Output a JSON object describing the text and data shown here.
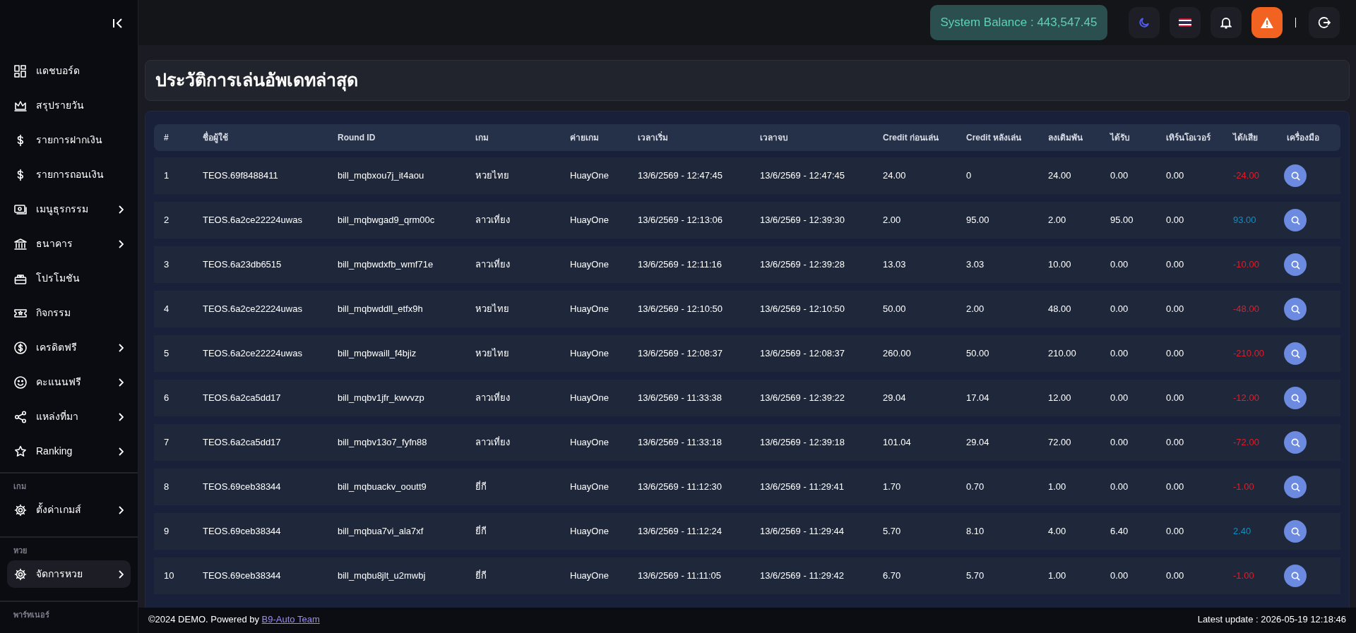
{
  "sidebar": {
    "sections": [
      {
        "items": [
          {
            "label": "แดชบอร์ด",
            "has_submenu": false,
            "selected": false
          },
          {
            "label": "สรุปรายวัน",
            "has_submenu": false,
            "selected": false
          },
          {
            "label": "รายการฝากเงิน",
            "has_submenu": false,
            "selected": false
          },
          {
            "label": "รายการถอนเงิน",
            "has_submenu": false,
            "selected": false
          },
          {
            "label": "เมนูธุรกรรม",
            "has_submenu": true,
            "selected": false
          },
          {
            "label": "ธนาคาร",
            "has_submenu": true,
            "selected": false
          },
          {
            "label": "โปรโมชัน",
            "has_submenu": false,
            "selected": false
          },
          {
            "label": "กิจกรรม",
            "has_submenu": false,
            "selected": false
          },
          {
            "label": "เครดิตฟรี",
            "has_submenu": true,
            "selected": false
          },
          {
            "label": "คะแนนฟรี",
            "has_submenu": true,
            "selected": false
          },
          {
            "label": "แหล่งที่มา",
            "has_submenu": true,
            "selected": false
          },
          {
            "label": "Ranking",
            "has_submenu": true,
            "selected": false
          }
        ]
      },
      {
        "label": "เกม",
        "items": [
          {
            "label": "ตั้งค่าเกมส์",
            "has_submenu": true,
            "selected": false
          }
        ]
      },
      {
        "label": "หวย",
        "items": [
          {
            "label": "จัดการหวย",
            "has_submenu": true,
            "selected": true
          }
        ]
      },
      {
        "label": "พาร์ทเนอร์"
      }
    ]
  },
  "header": {
    "balance": "System Balance : 443,547.45"
  },
  "page_title": "ประวัติการเล่นอัพเดทล่าสุด",
  "table": {
    "columns": [
      "#",
      "ชื่อผู้ใช้",
      "Round ID",
      "เกม",
      "ค่ายเกม",
      "เวลาเริ่ม",
      "เวลาจบ",
      "Credit ก่อนเล่น",
      "Credit หลังเล่น",
      "ลงเดิมพัน",
      "ได้รับ",
      "เทิร์นโอเวอร์",
      "ได้/เสีย",
      "เครื่องมือ"
    ],
    "rows": [
      {
        "cells": [
          "1",
          "TEOS.69f8488411",
          "bill_mqbxou7j_it4aou",
          "หวยไทย",
          "HuayOne",
          "13/6/2569 - 12:47:45",
          "13/6/2569 - 12:47:45",
          "24.00",
          "0",
          "24.00",
          "0.00",
          "0.00",
          "-24.00"
        ],
        "color": "#e11d2a"
      },
      {
        "cells": [
          "2",
          "TEOS.6a2ce22224uwas",
          "bill_mqbwgad9_qrm00c",
          "ลาวเที่ยง",
          "HuayOne",
          "13/6/2569 - 12:13:06",
          "13/6/2569 - 12:39:30",
          "2.00",
          "95.00",
          "2.00",
          "95.00",
          "0.00",
          "93.00"
        ],
        "color": "#0e8fc6"
      },
      {
        "cells": [
          "3",
          "TEOS.6a23db6515",
          "bill_mqbwdxfb_wmf71e",
          "ลาวเที่ยง",
          "HuayOne",
          "13/6/2569 - 12:11:16",
          "13/6/2569 - 12:39:28",
          "13.03",
          "3.03",
          "10.00",
          "0.00",
          "0.00",
          "-10.00"
        ],
        "color": "#e11d2a"
      },
      {
        "cells": [
          "4",
          "TEOS.6a2ce22224uwas",
          "bill_mqbwddll_etfx9h",
          "หวยไทย",
          "HuayOne",
          "13/6/2569 - 12:10:50",
          "13/6/2569 - 12:10:50",
          "50.00",
          "2.00",
          "48.00",
          "0.00",
          "0.00",
          "-48.00"
        ],
        "color": "#e11d2a"
      },
      {
        "cells": [
          "5",
          "TEOS.6a2ce22224uwas",
          "bill_mqbwaill_f4bjiz",
          "หวยไทย",
          "HuayOne",
          "13/6/2569 - 12:08:37",
          "13/6/2569 - 12:08:37",
          "260.00",
          "50.00",
          "210.00",
          "0.00",
          "0.00",
          "-210.00"
        ],
        "color": "#e11d2a"
      },
      {
        "cells": [
          "6",
          "TEOS.6a2ca5dd17",
          "bill_mqbv1jfr_kwvvzp",
          "ลาวเที่ยง",
          "HuayOne",
          "13/6/2569 - 11:33:38",
          "13/6/2569 - 12:39:22",
          "29.04",
          "17.04",
          "12.00",
          "0.00",
          "0.00",
          "-12.00"
        ],
        "color": "#e11d2a"
      },
      {
        "cells": [
          "7",
          "TEOS.6a2ca5dd17",
          "bill_mqbv13o7_fyfn88",
          "ลาวเที่ยง",
          "HuayOne",
          "13/6/2569 - 11:33:18",
          "13/6/2569 - 12:39:18",
          "101.04",
          "29.04",
          "72.00",
          "0.00",
          "0.00",
          "-72.00"
        ],
        "color": "#e11d2a"
      },
      {
        "cells": [
          "8",
          "TEOS.69ceb38344",
          "bill_mqbuackv_ooutt9",
          "ยี่กี",
          "HuayOne",
          "13/6/2569 - 11:12:30",
          "13/6/2569 - 11:29:41",
          "1.70",
          "0.70",
          "1.00",
          "0.00",
          "0.00",
          "-1.00"
        ],
        "color": "#e11d2a"
      },
      {
        "cells": [
          "9",
          "TEOS.69ceb38344",
          "bill_mqbua7vi_ala7xf",
          "ยี่กี",
          "HuayOne",
          "13/6/2569 - 11:12:24",
          "13/6/2569 - 11:29:44",
          "5.70",
          "8.10",
          "4.00",
          "6.40",
          "0.00",
          "2.40"
        ],
        "color": "#0e8fc6"
      },
      {
        "cells": [
          "10",
          "TEOS.69ceb38344",
          "bill_mqbu8jlt_u2mwbj",
          "ยี่กี",
          "HuayOne",
          "13/6/2569 - 11:11:05",
          "13/6/2569 - 11:29:42",
          "6.70",
          "5.70",
          "1.00",
          "0.00",
          "0.00",
          "-1.00"
        ],
        "color": "#e11d2a"
      }
    ]
  },
  "footer": {
    "copyright": "©2024 DEMO. Powered by",
    "link": "B9-Auto Team",
    "last_update": "Latest update : 2026-05-19 12:18:46"
  }
}
